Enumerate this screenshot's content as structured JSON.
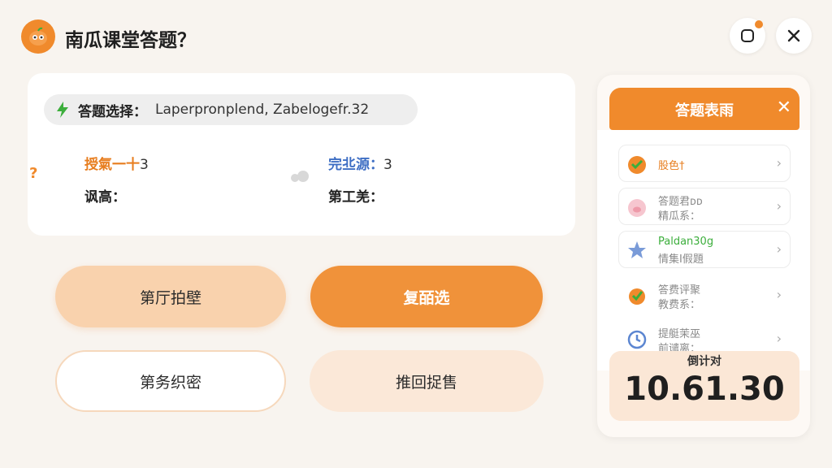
{
  "header": {
    "title": "南瓜课堂答题？",
    "logo_icon": "pumpkin-logo-icon",
    "minimize_icon": "minimize-icon",
    "close_icon": "close-icon"
  },
  "question": {
    "pill_label": "答题选择：",
    "pill_value": "Laperpronplend, Zabelogefr.32",
    "help_mark": "?",
    "meta_1_label": "授氣一十",
    "meta_1_value": "3",
    "meta_2_label": "讽高：",
    "meta_3_label": "完丠源：",
    "meta_3_value": "3",
    "meta_4_label": "第工羌："
  },
  "buttons": {
    "b1": "第厅拍壁",
    "b2": "复皕选",
    "b3": "第务织密",
    "b4": "推回捉售"
  },
  "side_panel": {
    "title": "答题表雨",
    "close": "✕",
    "items": [
      {
        "label": "股色†",
        "icon": "pumpkin-icon"
      },
      {
        "line1": "答题君ᴅᴅ",
        "line2": "精瓜系：",
        "icon": "pig-icon"
      },
      {
        "line1": "Paldan30g",
        "line2": "情集I假題",
        "icon": "star-icon"
      },
      {
        "line1": "答费评聚",
        "line2": "教费系：",
        "icon": "check-pumpkin-icon"
      },
      {
        "line1": "提艇茉巫",
        "line2": "前谴离：",
        "icon": "clock-icon"
      }
    ]
  },
  "timer": {
    "label": "倒计对",
    "value": "10.61.30"
  },
  "colors": {
    "accent": "#f08a2c",
    "accent_light": "#f9d2ad",
    "blue": "#3f6fc4",
    "green": "#3cae3c",
    "background": "#f8f4ef"
  }
}
